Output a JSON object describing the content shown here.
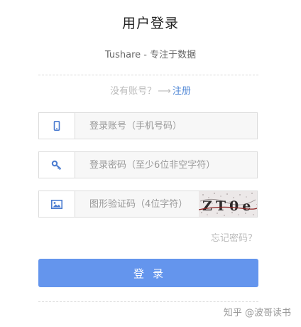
{
  "header": {
    "title": "用户登录",
    "subtitle": "Tushare - 专注于数据"
  },
  "register": {
    "prompt": "没有账号？",
    "arrow": "⟶",
    "link_label": "注册"
  },
  "form": {
    "account_placeholder": "登录账号（手机号码）",
    "password_placeholder": "登录密码（至少6位非空字符）",
    "captcha_placeholder": "图形验证码（4位字符）",
    "captcha_text": "ZT0e"
  },
  "forgot_label": "忘记密码？",
  "login_label": "登录",
  "watermark": "知乎 @波哥读书",
  "colors": {
    "accent": "#6495ed",
    "link": "#4a83d4",
    "icon": "#4a7bd0"
  }
}
